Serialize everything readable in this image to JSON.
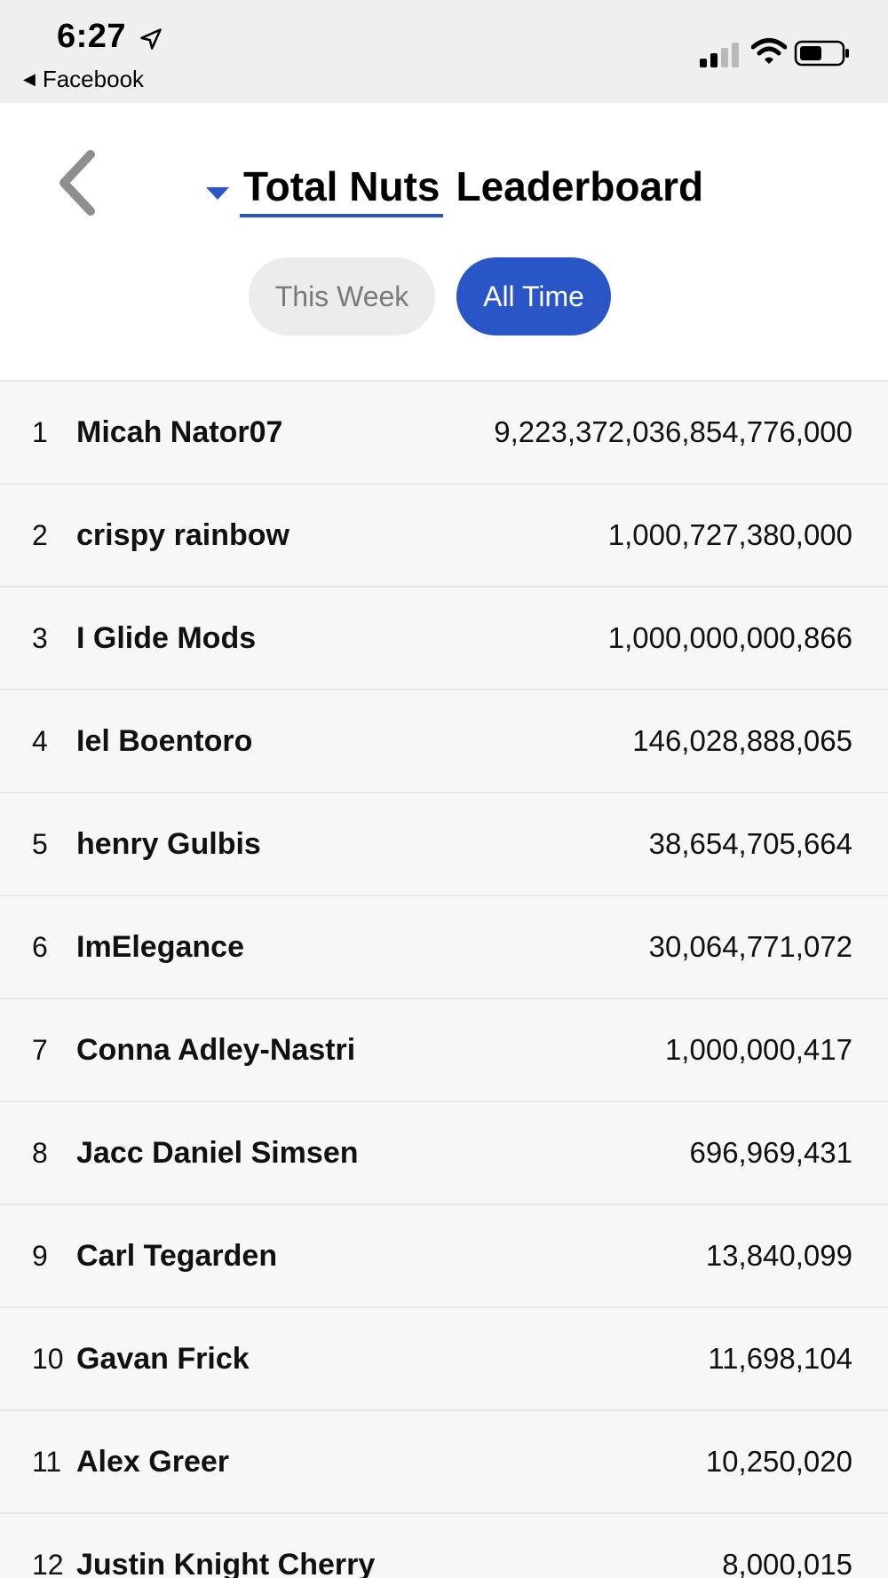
{
  "status_bar": {
    "time": "6:27",
    "back_app_label": "Facebook",
    "icons": [
      "location-arrow-icon",
      "signal-icon",
      "wifi-icon",
      "battery-icon"
    ]
  },
  "header": {
    "selector_value": "Total Nuts",
    "title_suffix": "Leaderboard",
    "tabs": [
      {
        "label": "This Week",
        "active": false
      },
      {
        "label": "All Time",
        "active": true
      }
    ]
  },
  "colors": {
    "accent": "#2a55c7",
    "status_bar_bg": "#efefef",
    "list_bg": "#f7f7f7",
    "inactive_tab_bg": "#ececec",
    "inactive_tab_text": "#7a7a7a"
  },
  "leaderboard": {
    "rows": [
      {
        "rank": "1",
        "name": "Micah Nator07",
        "score": "9,223,372,036,854,776,000"
      },
      {
        "rank": "2",
        "name": "crispy rainbow",
        "score": "1,000,727,380,000"
      },
      {
        "rank": "3",
        "name": "I Glide Mods",
        "score": "1,000,000,000,866"
      },
      {
        "rank": "4",
        "name": "Iel Boentoro",
        "score": "146,028,888,065"
      },
      {
        "rank": "5",
        "name": "henry Gulbis",
        "score": "38,654,705,664"
      },
      {
        "rank": "6",
        "name": "ImElegance",
        "score": "30,064,771,072"
      },
      {
        "rank": "7",
        "name": "Conna Adley-Nastri",
        "score": "1,000,000,417"
      },
      {
        "rank": "8",
        "name": "Jacc Daniel Simsen",
        "score": "696,969,431"
      },
      {
        "rank": "9",
        "name": "Carl Tegarden",
        "score": "13,840,099"
      },
      {
        "rank": "10",
        "name": "Gavan Frick",
        "score": "11,698,104"
      },
      {
        "rank": "11",
        "name": "Alex Greer",
        "score": "10,250,020"
      },
      {
        "rank": "12",
        "name": "Justin Knight Cherry",
        "score": "8,000,015"
      }
    ]
  }
}
